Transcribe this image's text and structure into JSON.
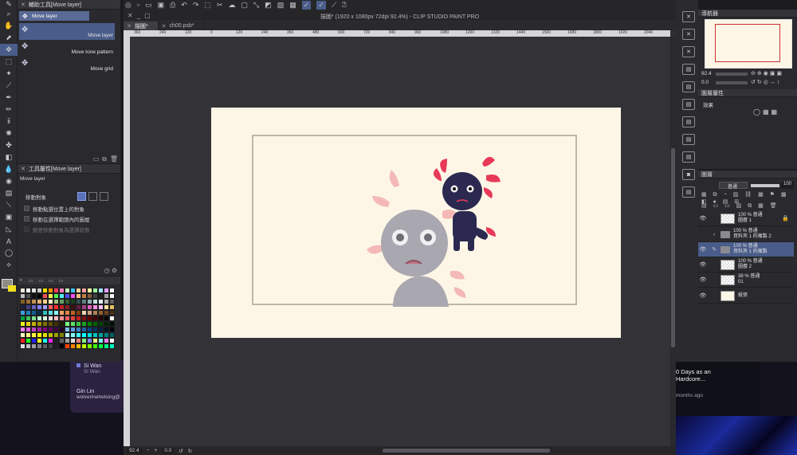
{
  "window_title": "描圖* (1920 x 1080px 72dpi 92.4%) - CLIP STUDIO PAINT PRO",
  "tabs": [
    {
      "label": "描圖*",
      "active": true
    },
    {
      "label": "ch00.psb*",
      "active": false
    }
  ],
  "sub_tool": {
    "panel_title": "輔助工具[Move layer]",
    "group_label": "Move layer",
    "items": [
      {
        "label": "Move layer",
        "selected": true
      },
      {
        "label": "Move tone pattern",
        "selected": false
      },
      {
        "label": "Move grid",
        "selected": false
      }
    ]
  },
  "tool_property": {
    "panel_title": "工具屬性[Move layer]",
    "tool_name": "Move layer",
    "target_label": "移動對象",
    "options": [
      {
        "label": "移動點選位置上的對象",
        "enabled": true
      },
      {
        "label": "移動在選擇範圍內的圖層",
        "enabled": true
      },
      {
        "label": "變更移動對象為選擇狀態",
        "enabled": false
      }
    ]
  },
  "colors": {
    "accent": "#4a5d8a",
    "foreground": "#8f8b85",
    "background": "#f0e020",
    "paper": "#fdf6e6",
    "swatches": [
      "#f0e8d8",
      "#fff",
      "#e0e0e0",
      "#c8c8c8",
      "#ffe000",
      "#ff9000",
      "#ff4060",
      "#ff80c0",
      "#c0ffc0",
      "#40c0ff",
      "#ffd0a0",
      "#ffa0a0",
      "#ffffa0",
      "#a0ffa0",
      "#a0e0ff",
      "#e0a0ff",
      "#ffffff",
      "#c0c0c0",
      "#505050",
      "#101010",
      "#000000",
      "#f05050",
      "#f0f050",
      "#50f050",
      "#50f0f0",
      "#5050f0",
      "#f050f0",
      "#ffc080",
      "#c08040",
      "#806040",
      "#404040",
      "#202020",
      "#a0a0a0",
      "#f8f8f8",
      "#806020",
      "#a07030",
      "#c09050",
      "#e0b070",
      "#ffd090",
      "#fff0c0",
      "#a0c080",
      "#60a060",
      "#306030",
      "#204020",
      "#305050",
      "#608080",
      "#90b0b0",
      "#c0e0e0",
      "#e0f0f0",
      "#b0b0b0",
      "#606060",
      "#202040",
      "#404080",
      "#6060c0",
      "#8080ff",
      "#a0a0ff",
      "#ff6060",
      "#ff3030",
      "#c02020",
      "#802020",
      "#401010",
      "#602040",
      "#a04080",
      "#e060c0",
      "#ff90e0",
      "#ffc0f0",
      "#ffe0a0",
      "#e0c060",
      "#40a0e0",
      "#2080c0",
      "#106090",
      "#083050",
      "#30c0c0",
      "#60e0e0",
      "#90ffff",
      "#f0a060",
      "#e08040",
      "#c06020",
      "#804010",
      "#f0d0b0",
      "#d0a080",
      "#b08050",
      "#906030",
      "#704020",
      "#503010",
      "#00a040",
      "#40c060",
      "#80e090",
      "#c0ffd0",
      "#e0ffe0",
      "#ffe0e0",
      "#ffc0c0",
      "#ff9090",
      "#ff6060",
      "#e04040",
      "#c02020",
      "#801010",
      "#600000",
      "#400000",
      "#200000",
      "#000000",
      "#ffffff",
      "#f0f020",
      "#e0d010",
      "#c0b000",
      "#a09000",
      "#807000",
      "#605000",
      "#403000",
      "#202000",
      "#80ff80",
      "#60e060",
      "#40c040",
      "#20a020",
      "#008000",
      "#006000",
      "#004000",
      "#002000",
      "#001000",
      "#ff80ff",
      "#e060e0",
      "#c040c0",
      "#a020a0",
      "#800080",
      "#600060",
      "#400040",
      "#200020",
      "#80c0ff",
      "#60a0e0",
      "#4080c0",
      "#2060a0",
      "#004080",
      "#003060",
      "#002040",
      "#001020",
      "#000010",
      "#ffffc0",
      "#ffff80",
      "#ffff40",
      "#ffff00",
      "#e0e000",
      "#c0c000",
      "#a0a000",
      "#808000",
      "#c0ffff",
      "#80ffff",
      "#40ffff",
      "#00ffff",
      "#00e0e0",
      "#00c0c0",
      "#00a0a0",
      "#008080",
      "#006060",
      "#ff2020",
      "#20ff20",
      "#2020ff",
      "#ffff20",
      "#20ffff",
      "#ff20ff",
      "#202020",
      "#606060",
      "#a0a0a0",
      "#e0e0e0",
      "#f08080",
      "#80f080",
      "#8080f0",
      "#f0f080",
      "#80f0f0",
      "#f080f0",
      "#ffffff",
      "#e0e0e0",
      "#c0c0c0",
      "#a0a0a0",
      "#808080",
      "#606060",
      "#404040",
      "#202020",
      "#000000",
      "#ff4000",
      "#ff8000",
      "#ffc000",
      "#c0ff00",
      "#80ff00",
      "#40ff00",
      "#00ff40",
      "#00ff80",
      "#00ffc0"
    ]
  },
  "ruler_h": [
    "360",
    "240",
    "120",
    "0",
    "120",
    "240",
    "360",
    "480",
    "600",
    "720",
    "840",
    "960",
    "1080",
    "1200",
    "1320",
    "1440",
    "1560",
    "1680",
    "1800",
    "1920",
    "2040"
  ],
  "status": {
    "zoom": "92.4",
    "rotation": "0.0"
  },
  "navigator": {
    "panel_title": "導航器",
    "zoom": "92.4",
    "rotation": "0.0"
  },
  "layer_property": {
    "panel_title": "圖層屬性",
    "effect_label": "效果"
  },
  "layers_panel": {
    "panel_title": "圖層",
    "blend_mode": "普通",
    "opacity": "100",
    "layers": [
      {
        "line1": "100 %  普通",
        "line2": "圖層 1",
        "type": "raster",
        "locked": true,
        "selected": false,
        "visible": true
      },
      {
        "line1": "100 %  普通",
        "line2": "資料夾 1 的複製 2",
        "type": "folder",
        "locked": false,
        "selected": false,
        "visible": false
      },
      {
        "line1": "100 %  普通",
        "line2": "資料夾 1 的複製",
        "type": "folder",
        "locked": false,
        "selected": true,
        "visible": true
      },
      {
        "line1": "100 %  普通",
        "line2": "圖層 2",
        "type": "raster",
        "locked": false,
        "selected": false,
        "visible": true
      },
      {
        "line1": "38 %  普通",
        "line2": "01",
        "type": "raster",
        "locked": false,
        "selected": false,
        "visible": true
      },
      {
        "line1": "",
        "line2": "紙張",
        "type": "paper",
        "locked": false,
        "selected": false,
        "visible": true
      }
    ]
  },
  "desktop": {
    "notif_left_name": "Si Wan",
    "notif_left_sub": "Si Wan",
    "notif_left_user": "Gin Lin",
    "notif_left_handle": "wolverinehelsing@",
    "notif_right_line1": "0 Days as an",
    "notif_right_line2": "Hardcore...",
    "notif_right_time": "months ago"
  }
}
